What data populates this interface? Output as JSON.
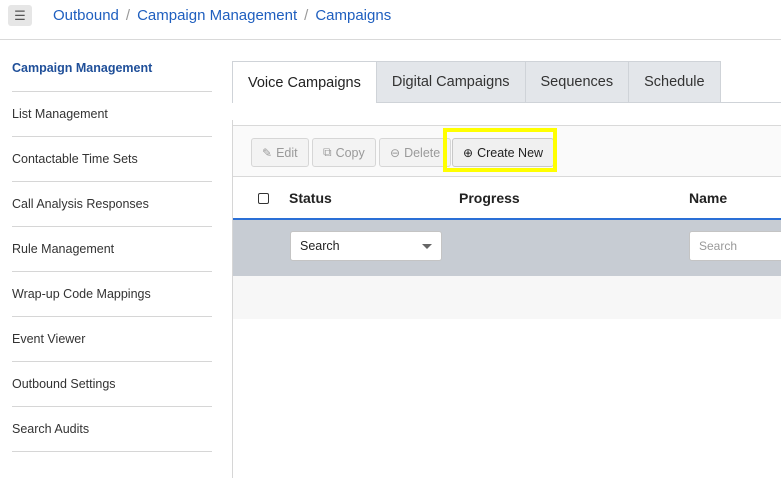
{
  "header": {
    "menu_icon": "hamburger-icon",
    "breadcrumb": [
      "Outbound",
      "Campaign Management",
      "Campaigns"
    ],
    "separator": "/"
  },
  "sidebar": {
    "items": [
      {
        "label": "Campaign Management",
        "active": true
      },
      {
        "label": "List Management"
      },
      {
        "label": "Contactable Time Sets"
      },
      {
        "label": "Call Analysis Responses"
      },
      {
        "label": "Rule Management"
      },
      {
        "label": "Wrap-up Code Mappings"
      },
      {
        "label": "Event Viewer"
      },
      {
        "label": "Outbound Settings"
      },
      {
        "label": "Search Audits"
      }
    ]
  },
  "tabs": [
    {
      "label": "Voice Campaigns",
      "active": true
    },
    {
      "label": "Digital Campaigns"
    },
    {
      "label": "Sequences"
    },
    {
      "label": "Schedule"
    }
  ],
  "toolbar": {
    "edit_label": "Edit",
    "copy_label": "Copy",
    "delete_label": "Delete",
    "create_label": "Create New",
    "highlight_color": "#ffff00"
  },
  "table": {
    "columns": [
      "Status",
      "Progress",
      "Name"
    ],
    "status_filter": "Search",
    "name_filter_placeholder": "Search"
  },
  "colors": {
    "link": "#1f5fbf",
    "header_underline": "#2a6fd6",
    "filter_row": "#c7ccd3"
  }
}
